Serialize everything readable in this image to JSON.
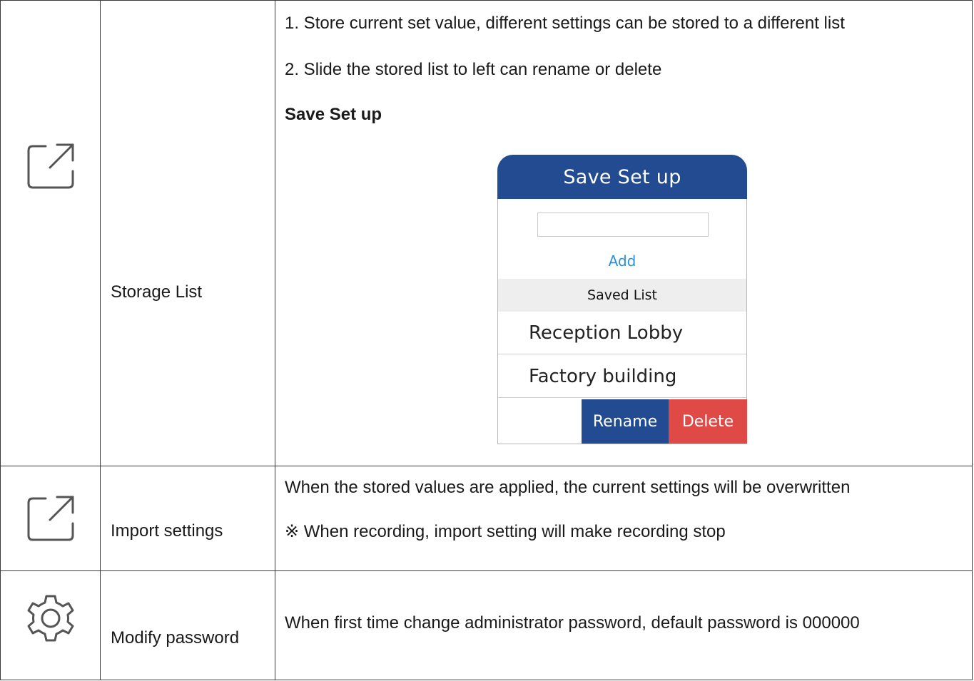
{
  "rows": [
    {
      "icon": "external-link-icon",
      "name": "Storage List",
      "lines": [
        "1.  Store current set value, different settings can be stored to a different list",
        "2.  Slide the stored list to left can rename or delete"
      ],
      "subheading": "Save Set up"
    },
    {
      "icon": "external-link-icon",
      "name": "Import settings",
      "lines": [
        "When the stored values are applied, the current settings will be overwritten",
        "※ When recording, import setting will make recording stop"
      ]
    },
    {
      "icon": "gear-icon",
      "name": "Modify password",
      "lines": [
        "When first time change administrator password, default password is 000000"
      ]
    }
  ],
  "dialog": {
    "title": "Save Set up",
    "input_value": "",
    "add_label": "Add",
    "saved_list_label": "Saved List",
    "items": [
      "Reception Lobby",
      "Factory building"
    ],
    "rename_label": "Rename",
    "delete_label": "Delete",
    "colors": {
      "header": "#234b91",
      "add_link": "#2f8fd6",
      "rename": "#234b91",
      "delete": "#e04a46"
    }
  }
}
